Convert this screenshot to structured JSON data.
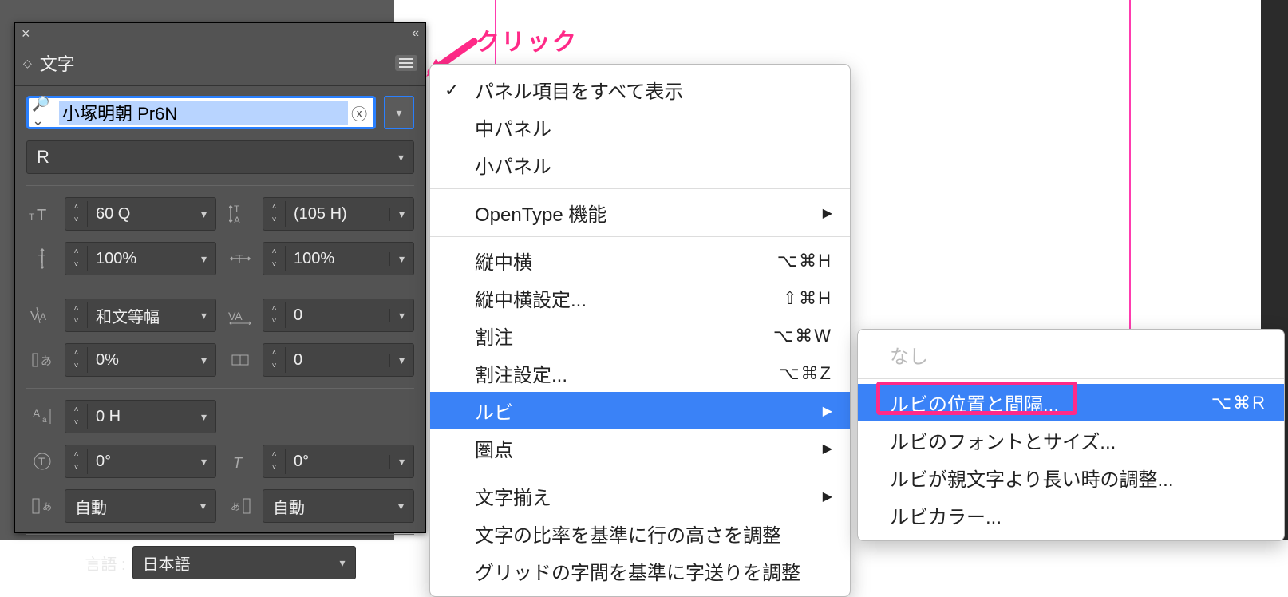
{
  "annotation": {
    "click_label": "クリック"
  },
  "panel": {
    "title": "文字",
    "font_family": "小塚明朝 Pr6N",
    "font_style": "R",
    "rows": {
      "size": "60 Q",
      "leading": "(105 H)",
      "vscale": "100%",
      "hscale": "100%",
      "kerning_mode": "和文等幅",
      "tracking": "0",
      "aki_left": "0%",
      "aki_right": "0",
      "baseline_shift": "0 H",
      "rotation": "0°",
      "skew": "0°",
      "auto1": "自動",
      "auto2": "自動"
    },
    "language_label": "言語 :",
    "language_value": "日本語"
  },
  "menu1": {
    "items": [
      {
        "label": "パネル項目をすべて表示",
        "checked": true
      },
      {
        "label": "中パネル"
      },
      {
        "label": "小パネル"
      },
      {
        "sep": true
      },
      {
        "label": "OpenType 機能",
        "submenu": true
      },
      {
        "sep": true
      },
      {
        "label": "縦中横",
        "shortcut": "⌥⌘H"
      },
      {
        "label": "縦中横設定...",
        "shortcut": "⇧⌘H"
      },
      {
        "label": "割注",
        "shortcut": "⌥⌘W"
      },
      {
        "label": "割注設定...",
        "shortcut": "⌥⌘Z"
      },
      {
        "label": "ルビ",
        "submenu": true,
        "highlight": true
      },
      {
        "label": "圏点",
        "submenu": true
      },
      {
        "sep": true
      },
      {
        "label": "文字揃え",
        "submenu": true
      },
      {
        "label": "文字の比率を基準に行の高さを調整"
      },
      {
        "label": "グリッドの字間を基準に字送りを調整"
      }
    ]
  },
  "menu2": {
    "items": [
      {
        "label": "なし",
        "disabled": true
      },
      {
        "sep": true
      },
      {
        "label": "ルビの位置と間隔...",
        "shortcut": "⌥⌘R",
        "highlight": true,
        "boxed": true
      },
      {
        "label": "ルビのフォントとサイズ..."
      },
      {
        "label": "ルビが親文字より長い時の調整..."
      },
      {
        "label": "ルビカラー..."
      }
    ]
  }
}
